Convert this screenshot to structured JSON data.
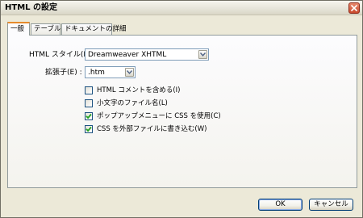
{
  "window": {
    "title": "HTML の設定"
  },
  "tabs": [
    {
      "label": "一般",
      "active": true
    },
    {
      "label": "テーブル",
      "active": false
    },
    {
      "label": "ドキュメントの詳細",
      "active": false
    }
  ],
  "general": {
    "html_style_label": "HTML スタイル(H) :",
    "html_style_value": "Dreamweaver XHTML",
    "extension_label": "拡張子(E) :",
    "extension_value": ".htm",
    "options": [
      {
        "label": "HTML コメントを含める(I)",
        "checked": false
      },
      {
        "label": "小文字のファイル名(L)",
        "checked": false
      },
      {
        "label": "ポップアップメニューに CSS を使用(C)",
        "checked": true
      },
      {
        "label": "CSS を外部ファイルに書き込む(W)",
        "checked": true
      }
    ]
  },
  "footer": {
    "ok_label": "OK",
    "cancel_label": "キャンセル"
  },
  "icons": {
    "close": "close-icon",
    "dropdown": "chevron-down-icon",
    "check": "checkmark-icon"
  },
  "colors": {
    "dialog_bg": "#ece9d8",
    "active_tab_accent": "#e68b2c",
    "check_color": "#21a121",
    "close_button": "#c9492c"
  }
}
